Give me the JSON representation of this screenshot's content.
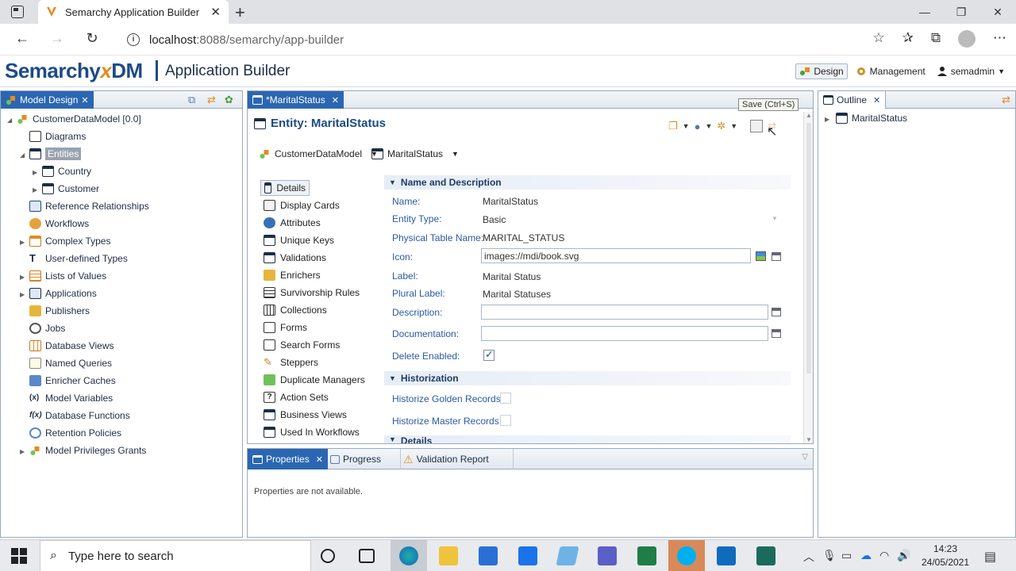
{
  "browser": {
    "tab_title": "Semarchy Application Builder",
    "url_host": "localhost",
    "url_rest": ":8088/semarchy/app-builder"
  },
  "header": {
    "logo_main": "Semarchy",
    "logo_x": "x",
    "logo_dm": "DM",
    "title": "Application Builder",
    "design": "Design",
    "management": "Management",
    "user": "semadmin"
  },
  "model_design": {
    "tab": "Model Design",
    "root": "CustomerDataModel [0.0]",
    "items": [
      {
        "label": "Diagrams"
      },
      {
        "label": "Entities"
      },
      {
        "label": "Country"
      },
      {
        "label": "Customer"
      },
      {
        "label": "Reference Relationships"
      },
      {
        "label": "Workflows"
      },
      {
        "label": "Complex Types"
      },
      {
        "label": "User-defined Types"
      },
      {
        "label": "Lists of Values"
      },
      {
        "label": "Applications"
      },
      {
        "label": "Publishers"
      },
      {
        "label": "Jobs"
      },
      {
        "label": "Database Views"
      },
      {
        "label": "Named Queries"
      },
      {
        "label": "Enricher Caches"
      },
      {
        "label": "Model Variables"
      },
      {
        "label": "Database Functions"
      },
      {
        "label": "Retention Policies"
      },
      {
        "label": "Model Privileges Grants"
      }
    ]
  },
  "editor": {
    "tab": "*MaritalStatus",
    "title": "Entity: MaritalStatus",
    "tooltip": "Save (Ctrl+S)",
    "breadcrumb": [
      "CustomerDataModel",
      "MaritalStatus"
    ],
    "nav": [
      "Details",
      "Display Cards",
      "Attributes",
      "Unique Keys",
      "Validations",
      "Enrichers",
      "Survivorship Rules",
      "Collections",
      "Forms",
      "Search Forms",
      "Steppers",
      "Duplicate Managers",
      "Action Sets",
      "Business Views",
      "Used In Workflows"
    ],
    "sections": {
      "name_desc": "Name and Description",
      "historization": "Historization",
      "details": "Details"
    },
    "fields": {
      "name_label": "Name:",
      "name_value": "MaritalStatus",
      "type_label": "Entity Type:",
      "type_value": "Basic",
      "table_label": "Physical Table Name:",
      "table_value": "MARITAL_STATUS",
      "icon_label": "Icon:",
      "icon_value": "images://mdi/book.svg",
      "label_label": "Label:",
      "label_value": "Marital Status",
      "plural_label": "Plural Label:",
      "plural_value": "Marital Statuses",
      "desc_label": "Description:",
      "desc_value": "",
      "doc_label": "Documentation:",
      "doc_value": "",
      "delete_label": "Delete Enabled:",
      "delete_enabled": true,
      "hist_golden_label": "Historize Golden Records:",
      "hist_golden": false,
      "hist_master_label": "Historize Master Records:",
      "hist_master": false
    }
  },
  "outline": {
    "tab": "Outline",
    "item": "MaritalStatus"
  },
  "bottom": {
    "tabs": [
      "Properties",
      "Progress",
      "Validation Report"
    ],
    "message": "Properties are not available."
  },
  "taskbar": {
    "search_placeholder": "Type here to search",
    "time": "14:23",
    "date": "24/05/2021"
  },
  "colors": {
    "accent": "#1d4b86",
    "orange": "#e58a1f",
    "selected": "#2b66b3"
  }
}
